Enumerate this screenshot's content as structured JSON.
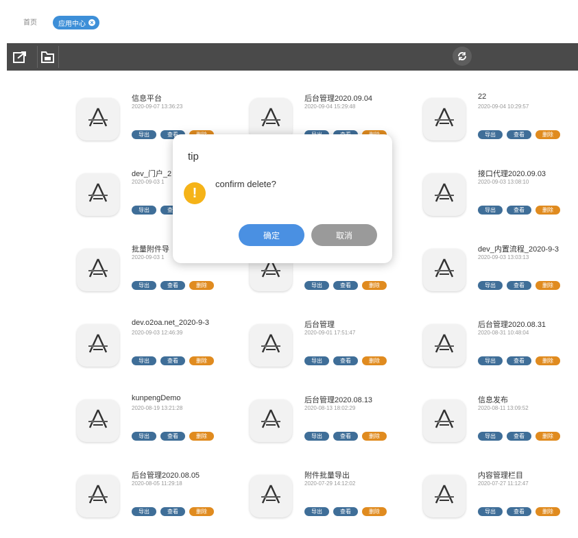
{
  "tabs": {
    "home": "首页",
    "active": "应用中心"
  },
  "toolbar": {
    "export_icon": "export-icon",
    "import_icon": "import-icon",
    "refresh_icon": "refresh-icon"
  },
  "apps": [
    {
      "name": "信息平台",
      "date": "2020-09-07 13:36:23"
    },
    {
      "name": "后台管理2020.09.04",
      "date": "2020-09-04 15:29:48"
    },
    {
      "name": "22",
      "date": "2020-09-04 10:29:57"
    },
    {
      "name": "dev_门户_2",
      "date": "2020-09-03 1"
    },
    {
      "name": "",
      "date": ""
    },
    {
      "name": "接口代理2020.09.03",
      "date": "2020-09-03 13:08:10"
    },
    {
      "name": "批量附件导",
      "date": "2020-09-03 1"
    },
    {
      "name": "-9-3",
      "date": ""
    },
    {
      "name": "dev_内置流程_2020-9-3",
      "date": "2020-09-03 13:03:13"
    },
    {
      "name": "dev.o2oa.net_2020-9-3",
      "date": "2020-09-03 12:46:39"
    },
    {
      "name": "后台管理",
      "date": "2020-09-01 17:51:47"
    },
    {
      "name": "后台管理2020.08.31",
      "date": "2020-08-31 10:48:04"
    },
    {
      "name": "kunpengDemo",
      "date": "2020-08-19 13:21:28"
    },
    {
      "name": "后台管理2020.08.13",
      "date": "2020-08-13 18:02:29"
    },
    {
      "name": "信息发布",
      "date": "2020-08-11 13:09:52"
    },
    {
      "name": "后台管理2020.08.05",
      "date": "2020-08-05 11:29:18"
    },
    {
      "name": "附件批量导出",
      "date": "2020-07-29 14:12:02"
    },
    {
      "name": "内容管理栏目",
      "date": "2020-07-27 11:12:47"
    }
  ],
  "card_buttons": {
    "export": "导出",
    "view": "查看",
    "delete": "删除"
  },
  "dialog": {
    "title": "tip",
    "message": "confirm delete?",
    "ok": "确定",
    "cancel": "取消",
    "icon": "warning-icon"
  },
  "colors": {
    "toolbar": "#4a4a4a",
    "accent": "#3d8fd8",
    "pill_blue": "#3f6e98",
    "pill_orange": "#e08b1f",
    "ok_button": "#4a90e2",
    "cancel_button": "#9a9a9a",
    "warning": "#f5b318"
  }
}
